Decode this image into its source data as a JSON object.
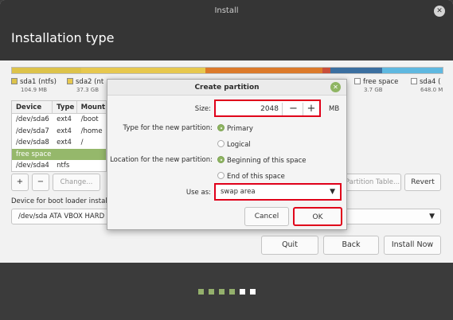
{
  "window": {
    "title": "Install",
    "close_icon": "close-icon",
    "page_title": "Installation type"
  },
  "partition_bar": {
    "segments": [
      {
        "color": "#ddc34a",
        "fraction": 0.16
      },
      {
        "color": "#e7c84e",
        "fraction": 0.29
      },
      {
        "color": "#dc7a2a",
        "fraction": 0.27
      },
      {
        "color": "#c94f3a",
        "fraction": 0.02
      },
      {
        "color": "#3b6fa0",
        "fraction": 0.12
      },
      {
        "color": "#5fb8e0",
        "fraction": 0.14
      }
    ]
  },
  "legend": [
    {
      "name": "sda1 (ntfs)",
      "size": "104.9 MB",
      "color": "#ddc34a"
    },
    {
      "name": "sda2 (nt",
      "size": "37.3 GB",
      "color": "#e7c84e"
    },
    {
      "name": "free space",
      "size": "3.7 GB",
      "color": "#ffffff"
    },
    {
      "name": "sda4 (",
      "size": "648.0 M",
      "color": "#ffffff"
    }
  ],
  "table": {
    "headers": [
      "Device",
      "Type",
      "Mount"
    ],
    "rows": [
      [
        "/dev/sda6",
        "ext4",
        "/boot"
      ],
      [
        "/dev/sda7",
        "ext4",
        "/home"
      ],
      [
        "/dev/sda8",
        "ext4",
        "/"
      ],
      [
        "free space",
        "",
        ""
      ],
      [
        "/dev/sda4",
        "ntfs",
        ""
      ]
    ],
    "selected_row": 3
  },
  "partition_buttons": {
    "add": "+",
    "remove": "−",
    "change": "Change...",
    "new_table": "Partition Table...",
    "revert": "Revert"
  },
  "boot_loader": {
    "label": "Device for boot loader instal",
    "value": "/dev/sda   ATA VBOX HARD",
    "arrow_icon": "triangle-down-icon"
  },
  "nav": {
    "quit": "Quit",
    "back": "Back",
    "install_now": "Install Now"
  },
  "progress_dots": {
    "total": 6,
    "completed": 4
  },
  "dialog": {
    "title": "Create partition",
    "size_label": "Size:",
    "size_value": "2048",
    "size_unit": "MB",
    "minus": "−",
    "plus": "+",
    "type_label": "Type for the new partition:",
    "type_options": [
      "Primary",
      "Logical"
    ],
    "type_selected": 0,
    "location_label": "Location for the new partition:",
    "location_options": [
      "Beginning of this space",
      "End of this space"
    ],
    "location_selected": 0,
    "use_as_label": "Use as:",
    "use_as_value": "swap area",
    "cancel": "Cancel",
    "ok": "OK",
    "highlight_color": "#e0001a",
    "accent_color": "#8fb563"
  }
}
